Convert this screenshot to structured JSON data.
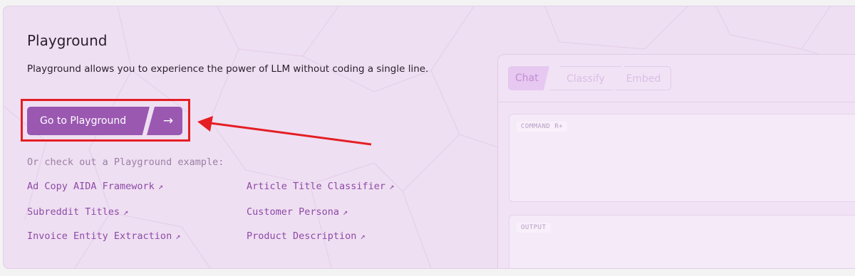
{
  "title": "Playground",
  "description": "Playground allows you to experience the power of LLM without coding a single line.",
  "cta": {
    "label": "Go to Playground",
    "arrow": "→"
  },
  "examples_label": "Or check out a Playground example:",
  "examples": [
    {
      "label": "Ad Copy AIDA Framework",
      "arrow": "↗"
    },
    {
      "label": "Article Title Classifier",
      "arrow": "↗"
    },
    {
      "label": "Subreddit Titles",
      "arrow": "↗"
    },
    {
      "label": "Customer Persona",
      "arrow": "↗"
    },
    {
      "label": "Invoice Entity Extraction",
      "arrow": "↗"
    },
    {
      "label": "Product Description",
      "arrow": "↗"
    }
  ],
  "preview": {
    "tabs": [
      "Chat",
      "Classify",
      "Embed"
    ],
    "active_tab": "Chat",
    "command_tag": "COMMAND R+",
    "output_tag": "OUTPUT"
  },
  "colors": {
    "card_bg": "#efdff2",
    "accent": "#9a58b1",
    "link": "#8d4ba6",
    "annotation_red": "#e41e24"
  }
}
